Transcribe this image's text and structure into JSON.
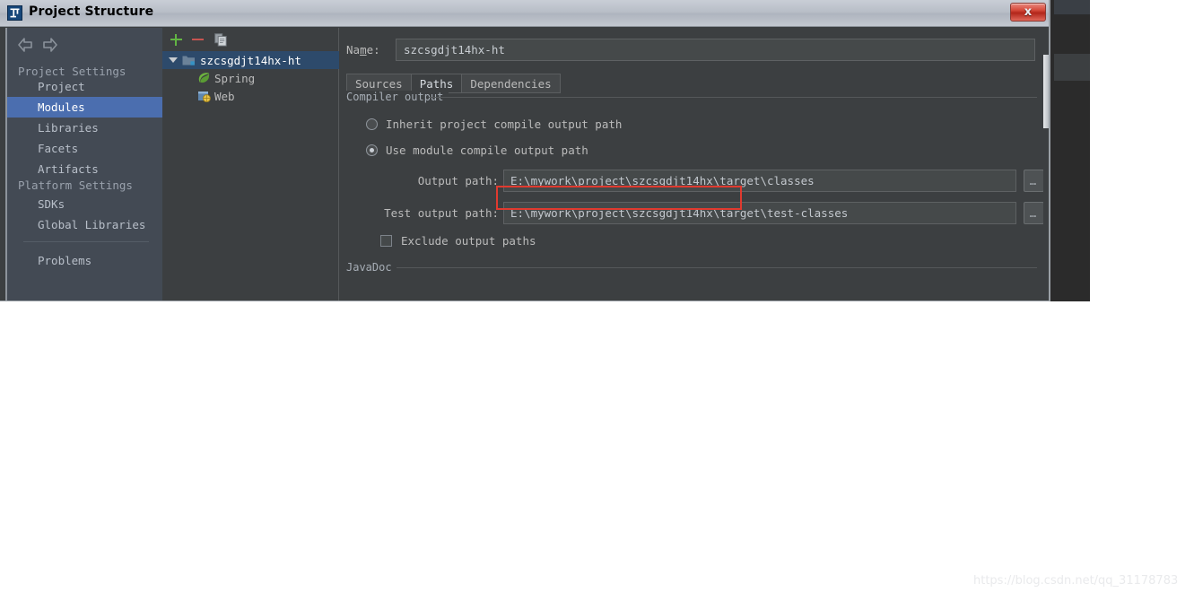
{
  "window": {
    "title": "Project Structure",
    "app_icon": "intellij-idea-icon",
    "close_label": "x"
  },
  "sidebar": {
    "nav_back_icon": "arrow-left-icon",
    "nav_forward_icon": "arrow-right-icon",
    "groups": [
      {
        "title": "Project Settings",
        "items": [
          {
            "label": "Project",
            "selected": false
          },
          {
            "label": "Modules",
            "selected": true
          },
          {
            "label": "Libraries",
            "selected": false
          },
          {
            "label": "Facets",
            "selected": false
          },
          {
            "label": "Artifacts",
            "selected": false
          }
        ]
      },
      {
        "title": "Platform Settings",
        "items": [
          {
            "label": "SDKs",
            "selected": false
          },
          {
            "label": "Global Libraries",
            "selected": false
          }
        ]
      }
    ],
    "footer_items": [
      {
        "label": "Problems",
        "selected": false
      }
    ]
  },
  "tree": {
    "toolbar": {
      "add_label": "+",
      "remove_label": "−",
      "copy_label": "copy-icon"
    },
    "nodes": [
      {
        "label": "szcsgdjt14hx-ht",
        "icon": "module-folder-icon",
        "selected": true,
        "expanded": true,
        "depth": 0
      },
      {
        "label": "Spring",
        "icon": "spring-leaf-icon",
        "selected": false,
        "expanded": false,
        "depth": 1
      },
      {
        "label": "Web",
        "icon": "web-facet-icon",
        "selected": false,
        "expanded": false,
        "depth": 1
      }
    ]
  },
  "main": {
    "name_label_pre": "Na",
    "name_label_mnemonic": "m",
    "name_label_post": "e:",
    "name_value": "szcsgdjt14hx-ht",
    "name_placeholder": "",
    "tabs": [
      {
        "label": "Sources",
        "active": false
      },
      {
        "label": "Paths",
        "active": true
      },
      {
        "label": "Dependencies",
        "active": false
      }
    ],
    "compiler_output": {
      "section_title": "Compiler output",
      "radios": [
        {
          "label": "Inherit project compile output path",
          "checked": false
        },
        {
          "label": "Use module compile output path",
          "checked": true
        }
      ],
      "fields": [
        {
          "label": "Output path:",
          "value": "E:\\mywork\\project\\szcsgdjt14hx\\target\\classes",
          "browse_label": "…",
          "highlighted": true
        },
        {
          "label": "Test output path:",
          "value": "E:\\mywork\\project\\szcsgdjt14hx\\target\\test-classes",
          "browse_label": "…",
          "highlighted": false
        }
      ],
      "checkbox": {
        "label": "Exclude output paths",
        "checked": false
      }
    },
    "javadoc": {
      "section_title": "JavaDoc"
    }
  },
  "colors": {
    "dialog_bg": "#3c3f41",
    "sidebar_bg": "#434a54",
    "selection_blue": "#4b6eaf",
    "tree_selection": "#2d4a6b",
    "accent_green": "#62b543",
    "accent_red": "#c75450",
    "highlight_red": "#e03a2f",
    "text": "#bbbbbb"
  },
  "watermark": {
    "text": "https://blog.csdn.net/qq_31178783"
  }
}
